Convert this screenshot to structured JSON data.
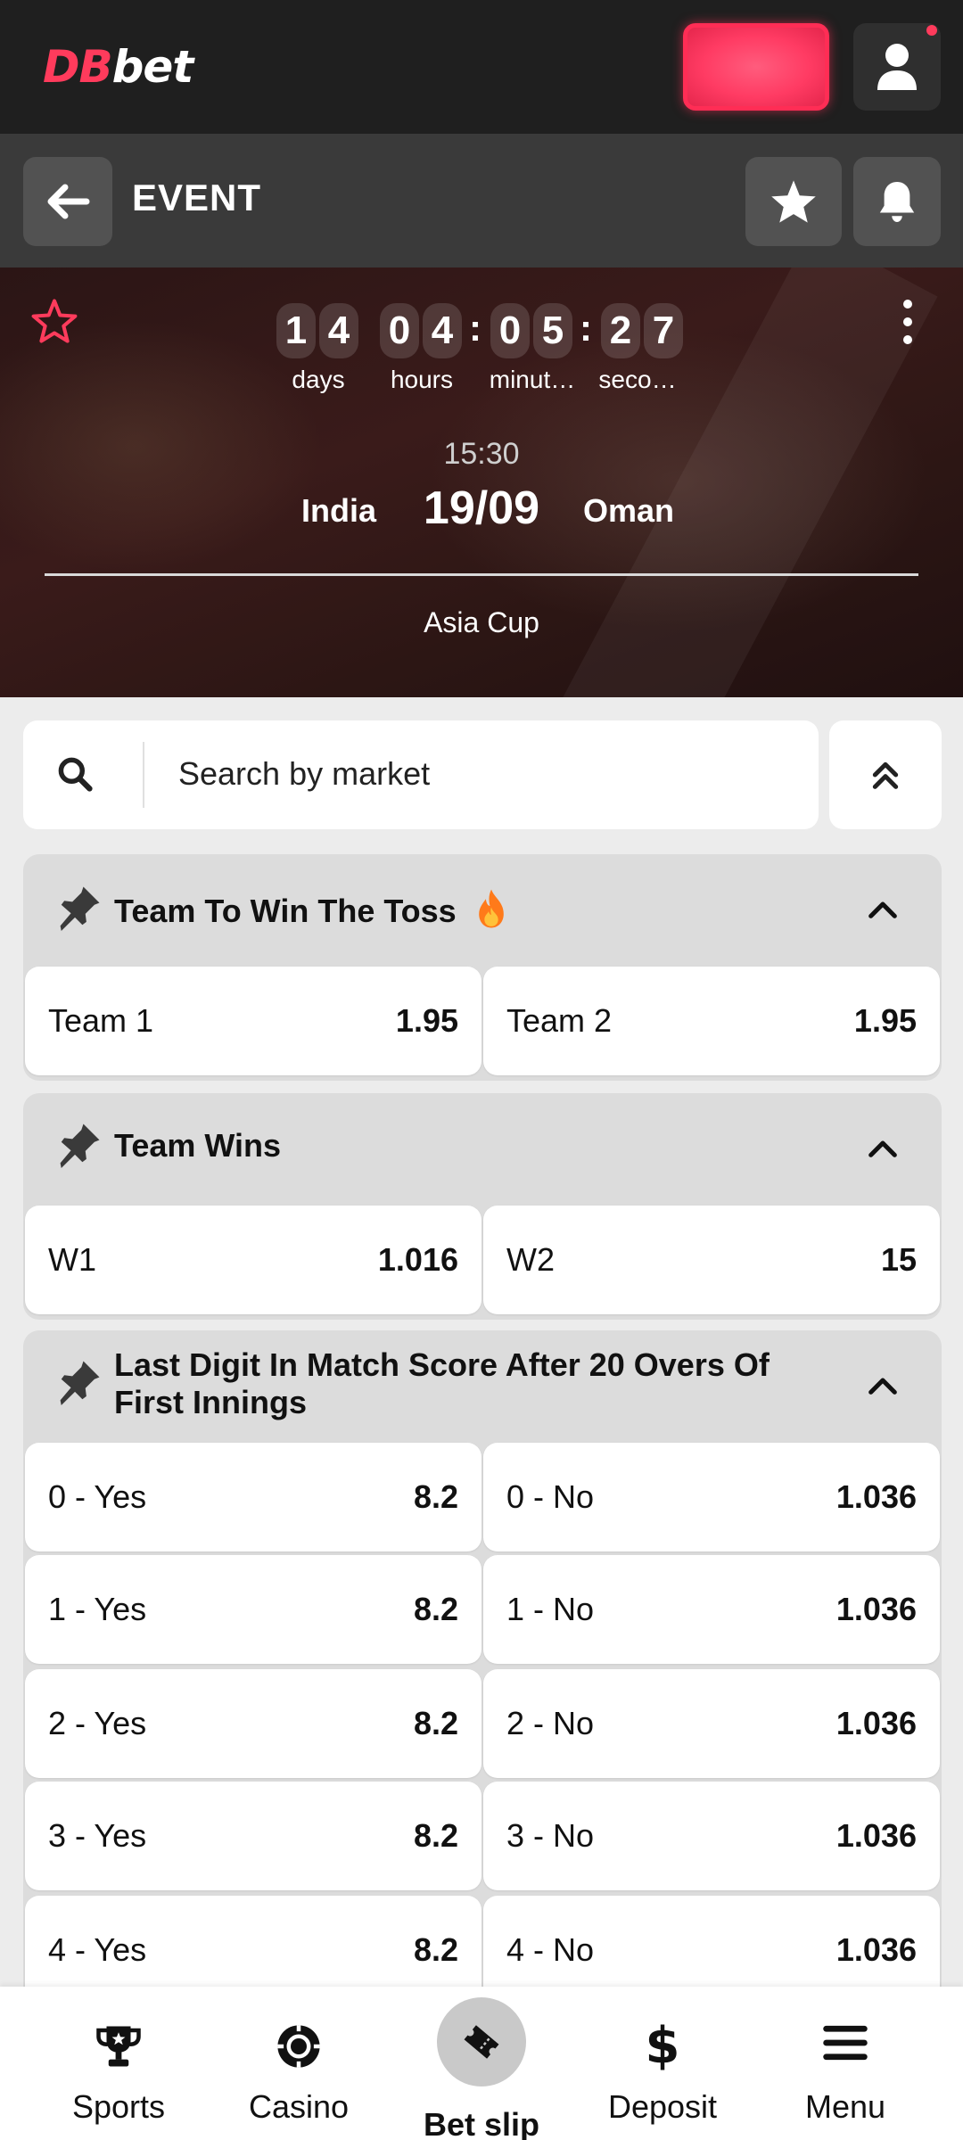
{
  "brand": {
    "logo_part1": "DB",
    "logo_part2": "bet"
  },
  "header": {
    "title": "EVENT"
  },
  "countdown": {
    "days_digits": [
      "1",
      "4"
    ],
    "hours_digits": [
      "0",
      "4"
    ],
    "minutes_digits": [
      "0",
      "5"
    ],
    "seconds_digits": [
      "2",
      "7"
    ],
    "labels": {
      "days": "days",
      "hours": "hours",
      "minutes": "minut…",
      "seconds": "seco…"
    }
  },
  "match": {
    "time": "15:30",
    "date": "19/09",
    "team1": "India",
    "team2": "Oman",
    "tournament": "Asia Cup"
  },
  "search": {
    "placeholder": "Search by market"
  },
  "markets": [
    {
      "title": "Team To Win The Toss",
      "hot_icon": "fire-icon",
      "outcomes": [
        {
          "label": "Team 1",
          "odds": "1.95"
        },
        {
          "label": "Team 2",
          "odds": "1.95"
        }
      ]
    },
    {
      "title": "Team Wins",
      "outcomes": [
        {
          "label": "W1",
          "odds": "1.016"
        },
        {
          "label": "W2",
          "odds": "15"
        }
      ]
    },
    {
      "title_line1": "Last Digit In Match Score After 20 Overs Of",
      "title_line2": "First Innings",
      "outcomes": [
        {
          "label": "0 - Yes",
          "odds": "8.2"
        },
        {
          "label": "0 - No",
          "odds": "1.036"
        },
        {
          "label": "1 - Yes",
          "odds": "8.2"
        },
        {
          "label": "1 - No",
          "odds": "1.036"
        },
        {
          "label": "2 - Yes",
          "odds": "8.2"
        },
        {
          "label": "2 - No",
          "odds": "1.036"
        },
        {
          "label": "3 - Yes",
          "odds": "8.2"
        },
        {
          "label": "3 - No",
          "odds": "1.036"
        },
        {
          "label": "4 - Yes",
          "odds": "8.2"
        },
        {
          "label": "4 - No",
          "odds": "1.036"
        }
      ]
    }
  ],
  "bottom_nav": {
    "sports": "Sports",
    "casino": "Casino",
    "betslip": "Bet slip",
    "deposit": "Deposit",
    "menu": "Menu"
  },
  "colors": {
    "accent": "#ff3b5c",
    "topbar": "#1f1f1f",
    "eventbar": "#3a3a3a",
    "page_bg": "#ececec"
  }
}
